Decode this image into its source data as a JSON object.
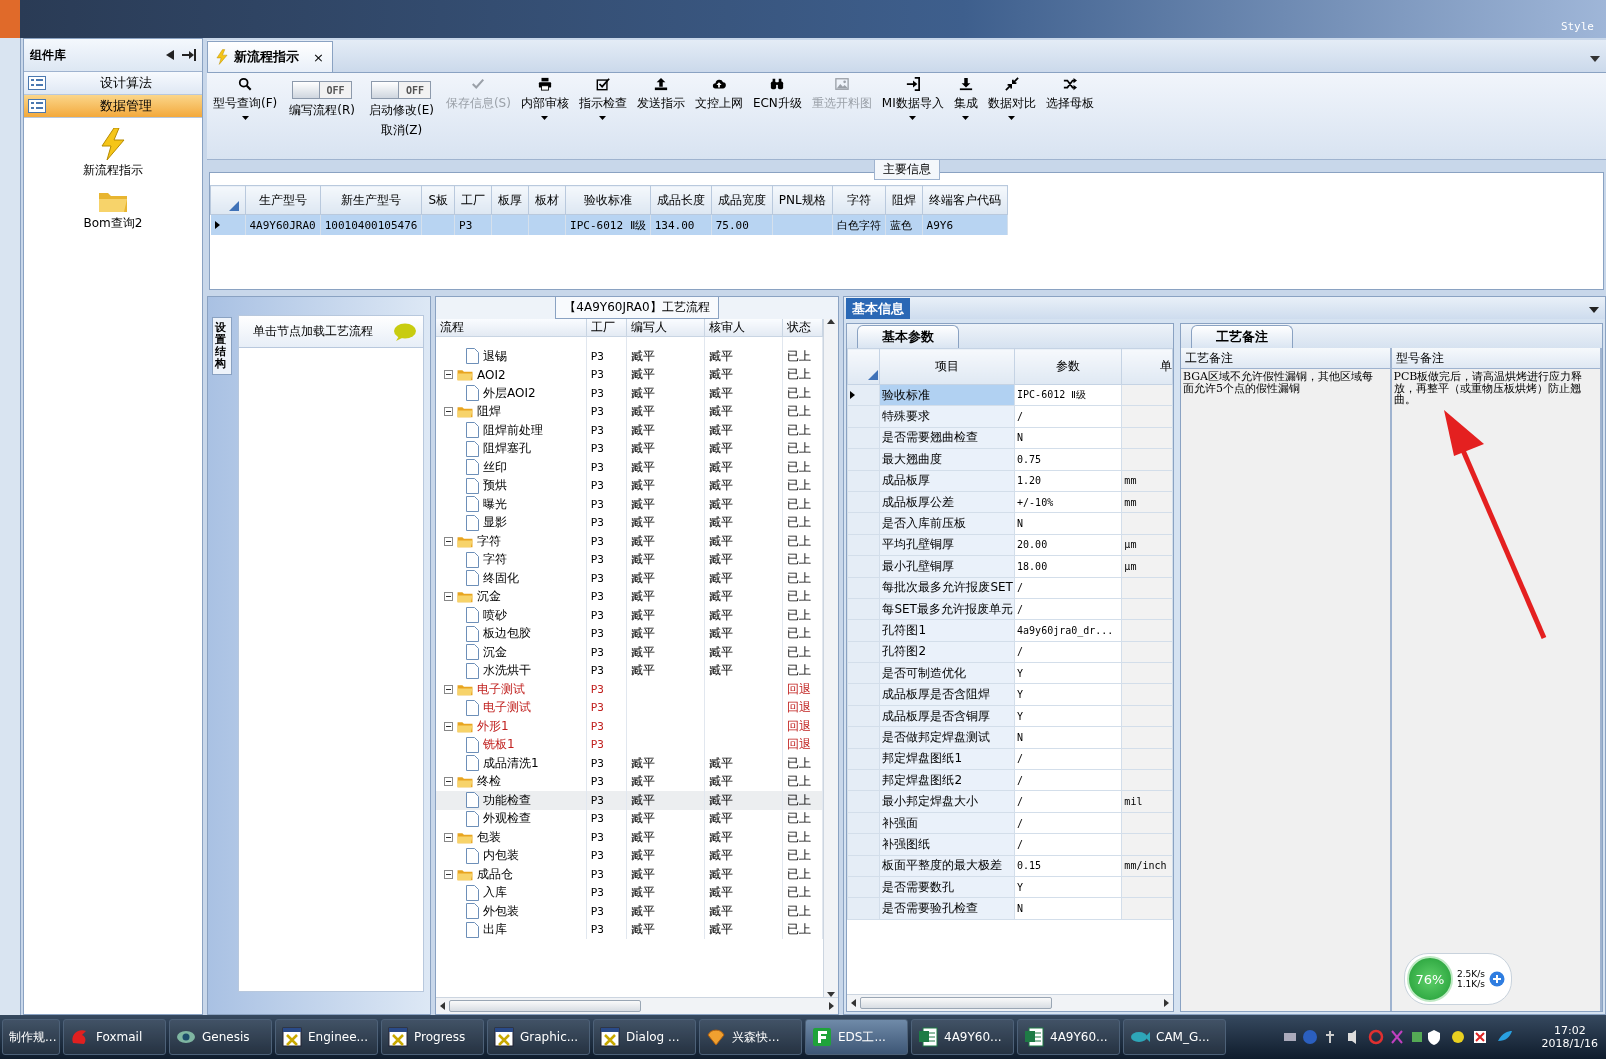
{
  "top_bar": {
    "style_label": "Style"
  },
  "sidebar": {
    "title": "组件库",
    "items": [
      {
        "label": "设计算法",
        "selected": false
      },
      {
        "label": "数据管理",
        "selected": true
      }
    ],
    "launchers": [
      {
        "label": "新流程指示"
      },
      {
        "label": "Bom查询2"
      }
    ]
  },
  "document_tab": {
    "title": "新流程指示",
    "close": "×"
  },
  "toolbar": {
    "items": [
      {
        "kind": "button",
        "label": "型号查询(F)",
        "disabled": false,
        "dropdown": true
      },
      {
        "kind": "toggle",
        "label": "编写流程(R)",
        "switch_text": "OFF",
        "on": false
      },
      {
        "kind": "toggle",
        "label": "启动修改(E)",
        "sublabel": "取消(Z)",
        "switch_text": "OFF",
        "on": false
      },
      {
        "kind": "button",
        "label": "保存信息(S)",
        "disabled": true,
        "dropdown": false
      },
      {
        "kind": "button",
        "label": "内部审核",
        "disabled": false,
        "dropdown": true
      },
      {
        "kind": "button",
        "label": "指示检查",
        "disabled": false,
        "dropdown": true
      },
      {
        "kind": "button",
        "label": "发送指示",
        "disabled": false,
        "dropdown": false
      },
      {
        "kind": "button",
        "label": "文控上网",
        "disabled": false,
        "dropdown": false
      },
      {
        "kind": "button",
        "label": "ECN升级",
        "disabled": false,
        "dropdown": false
      },
      {
        "kind": "button",
        "label": "重选开料图",
        "disabled": true,
        "dropdown": false
      },
      {
        "kind": "button",
        "label": "MI数据导入",
        "disabled": false,
        "dropdown": true
      },
      {
        "kind": "button",
        "label": "集成",
        "disabled": false,
        "dropdown": true
      },
      {
        "kind": "button",
        "label": "数据对比",
        "disabled": false,
        "dropdown": true
      },
      {
        "kind": "button",
        "label": "选择母板",
        "disabled": false,
        "dropdown": false
      }
    ]
  },
  "main_info": {
    "title": "主要信息",
    "columns": [
      "生产型号",
      "新生产型号",
      "S板",
      "工厂",
      "板厚",
      "板材",
      "验收标准",
      "成品长度",
      "成品宽度",
      "PNL规格",
      "字符",
      "阻焊",
      "终端客户代码"
    ],
    "rows": [
      {
        "selected": true,
        "cells": [
          "4A9Y60JRA0",
          "10010400105476",
          null,
          "P3",
          null,
          null,
          "IPC-6012 Ⅱ级",
          "134.00",
          "75.00",
          null,
          "白色字符",
          "蓝色",
          "A9Y6"
        ]
      }
    ]
  },
  "structure_panel": {
    "tab": "设置结构",
    "load_button": "单击节点加载工艺流程"
  },
  "process_tree": {
    "title": "【4A9Y60JRA0】工艺流程",
    "columns": [
      "流程",
      "工厂",
      "编写人",
      "核审人",
      "状态"
    ],
    "nodes": [
      {
        "label": "退锡",
        "factory": "P3",
        "writer": "臧平",
        "reviewer": "臧平",
        "status": "已上",
        "rejected": false,
        "selected": false
      },
      {
        "label": "AOI2",
        "expanded": true,
        "factory": "P3",
        "writer": "臧平",
        "reviewer": "臧平",
        "status": "已上",
        "rejected": false,
        "selected": false,
        "children": [
          {
            "label": "外层AOI2",
            "factory": "P3",
            "writer": "臧平",
            "reviewer": "臧平",
            "status": "已上",
            "rejected": false,
            "selected": false
          }
        ]
      },
      {
        "label": "阻焊",
        "expanded": true,
        "factory": "P3",
        "writer": "臧平",
        "reviewer": "臧平",
        "status": "已上",
        "rejected": false,
        "selected": false,
        "children": [
          {
            "label": "阻焊前处理",
            "factory": "P3",
            "writer": "臧平",
            "reviewer": "臧平",
            "status": "已上",
            "rejected": false,
            "selected": false
          },
          {
            "label": "阻焊塞孔",
            "factory": "P3",
            "writer": "臧平",
            "reviewer": "臧平",
            "status": "已上",
            "rejected": false,
            "selected": false
          },
          {
            "label": "丝印",
            "factory": "P3",
            "writer": "臧平",
            "reviewer": "臧平",
            "status": "已上",
            "rejected": false,
            "selected": false
          },
          {
            "label": "预烘",
            "factory": "P3",
            "writer": "臧平",
            "reviewer": "臧平",
            "status": "已上",
            "rejected": false,
            "selected": false
          },
          {
            "label": "曝光",
            "factory": "P3",
            "writer": "臧平",
            "reviewer": "臧平",
            "status": "已上",
            "rejected": false,
            "selected": false
          },
          {
            "label": "显影",
            "factory": "P3",
            "writer": "臧平",
            "reviewer": "臧平",
            "status": "已上",
            "rejected": false,
            "selected": false
          }
        ]
      },
      {
        "label": "字符",
        "expanded": true,
        "factory": "P3",
        "writer": "臧平",
        "reviewer": "臧平",
        "status": "已上",
        "rejected": false,
        "selected": false,
        "children": [
          {
            "label": "字符",
            "factory": "P3",
            "writer": "臧平",
            "reviewer": "臧平",
            "status": "已上",
            "rejected": false,
            "selected": false
          },
          {
            "label": "终固化",
            "factory": "P3",
            "writer": "臧平",
            "reviewer": "臧平",
            "status": "已上",
            "rejected": false,
            "selected": false
          }
        ]
      },
      {
        "label": "沉金",
        "expanded": true,
        "factory": "P3",
        "writer": "臧平",
        "reviewer": "臧平",
        "status": "已上",
        "rejected": false,
        "selected": false,
        "children": [
          {
            "label": "喷砂",
            "factory": "P3",
            "writer": "臧平",
            "reviewer": "臧平",
            "status": "已上",
            "rejected": false,
            "selected": false
          },
          {
            "label": "板边包胶",
            "factory": "P3",
            "writer": "臧平",
            "reviewer": "臧平",
            "status": "已上",
            "rejected": false,
            "selected": false
          },
          {
            "label": "沉金",
            "factory": "P3",
            "writer": "臧平",
            "reviewer": "臧平",
            "status": "已上",
            "rejected": false,
            "selected": false
          },
          {
            "label": "水洗烘干",
            "factory": "P3",
            "writer": "臧平",
            "reviewer": "臧平",
            "status": "已上",
            "rejected": false,
            "selected": false
          }
        ]
      },
      {
        "label": "电子测试",
        "expanded": true,
        "factory": "P3",
        "status": "回退",
        "rejected": true,
        "selected": false,
        "children": [
          {
            "label": "电子测试",
            "factory": "P3",
            "status": "回退",
            "rejected": true,
            "selected": false
          }
        ]
      },
      {
        "label": "外形1",
        "expanded": true,
        "factory": "P3",
        "status": "回退",
        "rejected": true,
        "selected": false,
        "children": [
          {
            "label": "铣板1",
            "factory": "P3",
            "status": "回退",
            "rejected": true,
            "selected": false
          },
          {
            "label": "成品清洗1",
            "factory": "P3",
            "writer": "臧平",
            "reviewer": "臧平",
            "status": "已上",
            "rejected": false,
            "selected": false
          }
        ]
      },
      {
        "label": "终检",
        "expanded": true,
        "factory": "P3",
        "writer": "臧平",
        "reviewer": "臧平",
        "status": "已上",
        "rejected": false,
        "selected": false,
        "children": [
          {
            "label": "功能检查",
            "factory": "P3",
            "writer": "臧平",
            "reviewer": "臧平",
            "status": "已上",
            "rejected": false,
            "selected": true
          },
          {
            "label": "外观检查",
            "factory": "P3",
            "writer": "臧平",
            "reviewer": "臧平",
            "status": "已上",
            "rejected": false,
            "selected": false
          }
        ]
      },
      {
        "label": "包装",
        "expanded": true,
        "factory": "P3",
        "writer": "臧平",
        "reviewer": "臧平",
        "status": "已上",
        "rejected": false,
        "selected": false,
        "children": [
          {
            "label": "内包装",
            "factory": "P3",
            "writer": "臧平",
            "reviewer": "臧平",
            "status": "已上",
            "rejected": false,
            "selected": false
          }
        ]
      },
      {
        "label": "成品仓",
        "expanded": true,
        "factory": "P3",
        "writer": "臧平",
        "reviewer": "臧平",
        "status": "已上",
        "rejected": false,
        "selected": false,
        "children": [
          {
            "label": "入库",
            "factory": "P3",
            "writer": "臧平",
            "reviewer": "臧平",
            "status": "已上",
            "rejected": false,
            "selected": false
          },
          {
            "label": "外包装",
            "factory": "P3",
            "writer": "臧平",
            "reviewer": "臧平",
            "status": "已上",
            "rejected": false,
            "selected": false
          },
          {
            "label": "出库",
            "factory": "P3",
            "writer": "臧平",
            "reviewer": "臧平",
            "status": "已上",
            "rejected": false,
            "selected": false
          }
        ]
      }
    ]
  },
  "info_panel": {
    "tabs": [
      {
        "label": "基本信息",
        "selected": true
      }
    ],
    "params": {
      "tab": "基本参数",
      "columns": [
        "项目",
        "参数",
        "单"
      ],
      "rows": [
        {
          "item": "验收标准",
          "value": "IPC-6012 Ⅱ级",
          "selected": true
        },
        {
          "item": "特殊要求",
          "value": "/",
          "selected": false
        },
        {
          "item": "是否需要翘曲检查",
          "value": "N",
          "selected": false
        },
        {
          "item": "最大翘曲度",
          "value": "0.75",
          "selected": false
        },
        {
          "item": "成品板厚",
          "value": "1.20",
          "unit": "mm",
          "selected": false
        },
        {
          "item": "成品板厚公差",
          "value": "+/-10%",
          "unit": "mm",
          "selected": false
        },
        {
          "item": "是否入库前压板",
          "value": "N",
          "selected": false
        },
        {
          "item": "平均孔壁铜厚",
          "value": "20.00",
          "unit": "μm",
          "selected": false
        },
        {
          "item": "最小孔壁铜厚",
          "value": "18.00",
          "unit": "μm",
          "selected": false
        },
        {
          "item": "每批次最多允许报废SET",
          "value": "/",
          "selected": false
        },
        {
          "item": "每SET最多允许报废单元",
          "value": "/",
          "selected": false
        },
        {
          "item": "孔符图1",
          "value": "4a9y60jra0_dr...",
          "selected": false
        },
        {
          "item": "孔符图2",
          "value": "/",
          "selected": false
        },
        {
          "item": "是否可制造优化",
          "value": "Y",
          "selected": false
        },
        {
          "item": "成品板厚是否含阻焊",
          "value": "Y",
          "selected": false
        },
        {
          "item": "成品板厚是否含铜厚",
          "value": "Y",
          "selected": false
        },
        {
          "item": "是否做邦定焊盘测试",
          "value": "N",
          "selected": false
        },
        {
          "item": "邦定焊盘图纸1",
          "value": "/",
          "selected": false
        },
        {
          "item": "邦定焊盘图纸2",
          "value": "/",
          "selected": false
        },
        {
          "item": "最小邦定焊盘大小",
          "value": "/",
          "unit": "mil",
          "selected": false
        },
        {
          "item": "补强面",
          "value": "/",
          "selected": false
        },
        {
          "item": "补强图纸",
          "value": "/",
          "selected": false
        },
        {
          "item": "板面平整度的最大极差",
          "value": "0.15",
          "unit": "mm/inch",
          "selected": false
        },
        {
          "item": "是否需要数孔",
          "value": "Y",
          "selected": false
        },
        {
          "item": "是否需要验孔检查",
          "value": "N",
          "selected": false
        }
      ]
    },
    "notes": {
      "tab": "工艺备注",
      "columns": [
        {
          "title": "工艺备注",
          "text": "BGA区域不允许假性漏铜，其他区域每面允许5个点的假性漏铜"
        },
        {
          "title": "型号备注",
          "text": "PCB板做完后，请高温烘烤进行应力释放，再整平（或重物压板烘烤）防止翘曲。"
        }
      ]
    }
  },
  "network_widget": {
    "percent": "76%",
    "upload": "2.5K/s",
    "download": "1.1K/s"
  },
  "taskbar": {
    "items": [
      {
        "label": "制作规...",
        "selected": false
      },
      {
        "label": "Foxmail",
        "selected": false
      },
      {
        "label": "Genesis",
        "selected": false
      },
      {
        "label": "Enginee...",
        "selected": false
      },
      {
        "label": "Progress",
        "selected": false
      },
      {
        "label": "Graphic...",
        "selected": false
      },
      {
        "label": "Dialog ...",
        "selected": false
      },
      {
        "label": "兴森快...",
        "selected": false
      },
      {
        "label": "EDS工...",
        "selected": true
      },
      {
        "label": "4A9Y60...",
        "selected": false
      },
      {
        "label": "4A9Y60...",
        "selected": false
      },
      {
        "label": "CAM_G...",
        "selected": false
      }
    ],
    "time": "17:02",
    "date": "2018/1/16"
  }
}
